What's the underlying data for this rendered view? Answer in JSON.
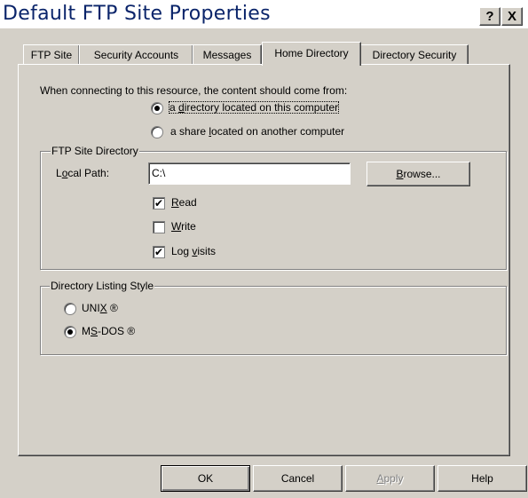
{
  "window": {
    "title": "Default FTP Site Properties",
    "help_button": "?",
    "close_button": "X"
  },
  "tabs": [
    {
      "label": "FTP Site"
    },
    {
      "label": "Security Accounts"
    },
    {
      "label": "Messages"
    },
    {
      "label": "Home Directory",
      "active": true
    },
    {
      "label": "Directory Security"
    }
  ],
  "content_source": {
    "prompt": "When connecting to this resource, the content should come from:",
    "option_local": {
      "pre": "a ",
      "key": "d",
      "post": "irectory located on this computer",
      "selected": true
    },
    "option_share": {
      "pre": "a share ",
      "key": "l",
      "post": "ocated on another computer",
      "selected": false
    }
  },
  "ftp_site_directory": {
    "group_label": "FTP Site Directory",
    "local_path_label": {
      "pre": "L",
      "key": "o",
      "post": "cal Path:"
    },
    "local_path_value": "C:\\",
    "browse_button": {
      "pre": "",
      "key": "B",
      "post": "rowse..."
    },
    "read": {
      "pre": "",
      "key": "R",
      "post": "ead",
      "checked": true
    },
    "write": {
      "pre": "",
      "key": "W",
      "post": "rite",
      "checked": false
    },
    "log_visits": {
      "pre": "Log ",
      "key": "v",
      "post": "isits",
      "checked": true
    }
  },
  "directory_listing_style": {
    "group_label": "Directory Listing Style",
    "unix": {
      "pre": "UNI",
      "key": "X",
      "post": " ®",
      "selected": false
    },
    "msdos": {
      "pre": "M",
      "key": "S",
      "post": "-DOS ®",
      "selected": true
    }
  },
  "footer": {
    "ok": "OK",
    "cancel": "Cancel",
    "apply": {
      "pre": "",
      "key": "A",
      "post": "pply"
    },
    "help": "Help"
  },
  "colors": {
    "face": "#d4d0c8",
    "title_text": "#0a246a",
    "shadow": "#808080",
    "highlight": "#ffffff"
  }
}
